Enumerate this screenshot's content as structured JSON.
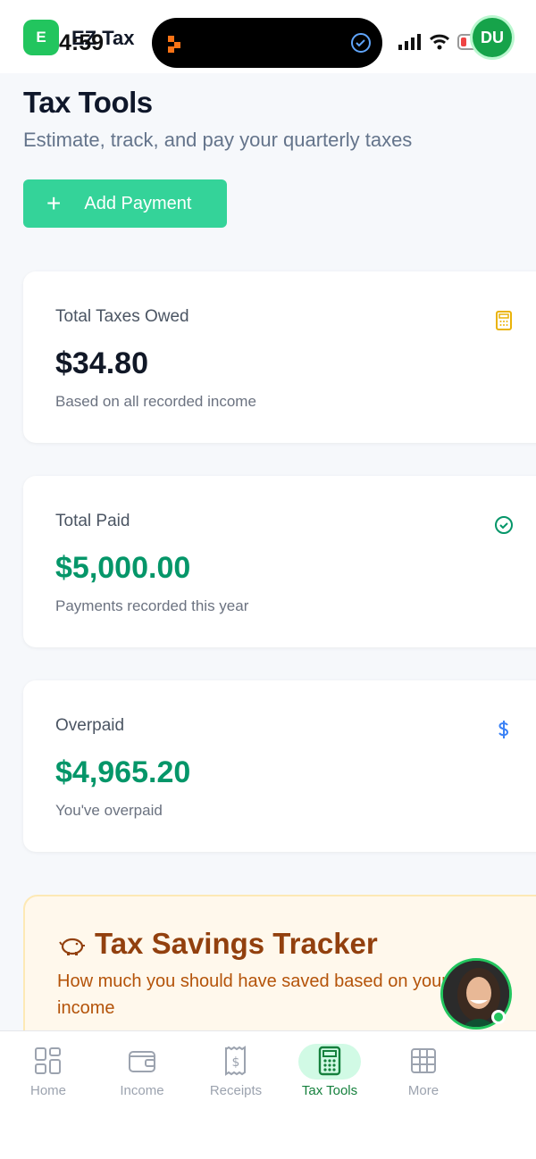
{
  "app": {
    "badge": "E",
    "name": "EZ Tax",
    "user_initials": "DU"
  },
  "status_bar": {
    "time": "4:59"
  },
  "header": {
    "title": "Tax Tools",
    "subtitle": "Estimate, track, and pay your quarterly taxes",
    "add_button": "Add Payment"
  },
  "cards": [
    {
      "label": "Total Taxes Owed",
      "amount": "$34.80",
      "note": "Based on all recorded income",
      "icon": "calculator-icon",
      "amount_color": "#111827",
      "icon_color": "#eab308"
    },
    {
      "label": "Total Paid",
      "amount": "$5,000.00",
      "note": "Payments recorded this year",
      "icon": "check-circle-icon",
      "amount_color": "#059669",
      "icon_color": "#059669"
    },
    {
      "label": "Overpaid",
      "amount": "$4,965.20",
      "note": "You've overpaid",
      "icon": "dollar-icon",
      "amount_color": "#059669",
      "icon_color": "#3b82f6"
    }
  ],
  "tracker": {
    "title": "Tax Savings Tracker",
    "subtitle": "How much you should have saved based on your income",
    "icon": "piggy-bank-icon"
  },
  "nav": {
    "items": [
      {
        "label": "Home",
        "icon": "grid-icon"
      },
      {
        "label": "Income",
        "icon": "wallet-icon"
      },
      {
        "label": "Receipts",
        "icon": "receipt-icon"
      },
      {
        "label": "Tax Tools",
        "icon": "calculator-icon",
        "active": true
      },
      {
        "label": "More",
        "icon": "table-icon"
      }
    ]
  },
  "colors": {
    "accent": "#34d399",
    "brand_green": "#22c55e",
    "tracker_title": "#92400e"
  }
}
